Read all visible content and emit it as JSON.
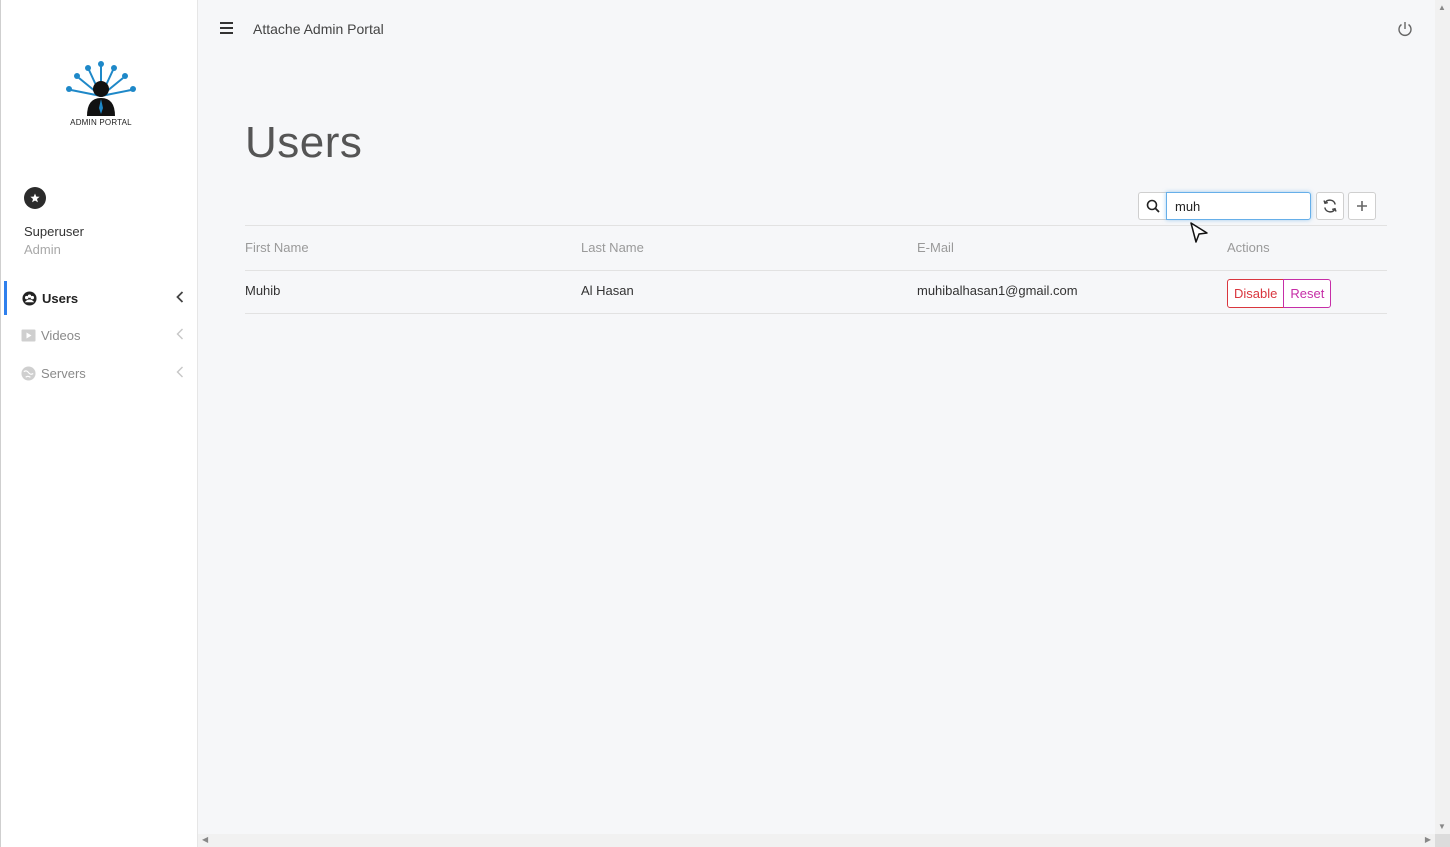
{
  "sidebar": {
    "logo_text": "ADMIN PORTAL",
    "user": {
      "name": "Superuser",
      "role": "Admin"
    },
    "items": [
      {
        "label": "Users",
        "icon": "users-icon",
        "active": true
      },
      {
        "label": "Videos",
        "icon": "video-icon",
        "active": false
      },
      {
        "label": "Servers",
        "icon": "globe-icon",
        "active": false
      }
    ]
  },
  "topbar": {
    "title": "Attache Admin Portal"
  },
  "page": {
    "title": "Users"
  },
  "search": {
    "value": "muh"
  },
  "table": {
    "headers": [
      "First Name",
      "Last Name",
      "E-Mail",
      "Actions"
    ],
    "rows": [
      {
        "first_name": "Muhib",
        "last_name": "Al Hasan",
        "email": "muhibalhasan1@gmail.com",
        "disable_label": "Disable",
        "reset_label": "Reset"
      }
    ]
  },
  "colors": {
    "accent": "#2f80ed",
    "disable": "#d9363e",
    "reset": "#c62ea7",
    "logo_blue": "#1e88c8"
  }
}
